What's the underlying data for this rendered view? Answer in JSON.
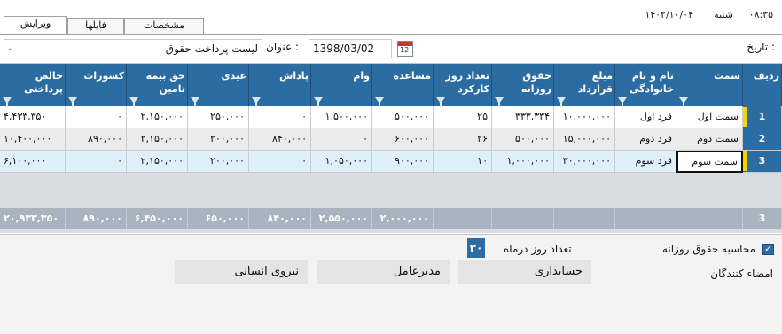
{
  "tabs": [
    {
      "label": "ویرایش",
      "active": true
    },
    {
      "label": "فایلها",
      "active": false
    },
    {
      "label": "مشخصات",
      "active": false
    }
  ],
  "status": {
    "time": "۰۸:۳۵",
    "day": "شنبه",
    "date": "۱۴۰۲/۱۰/۰۴"
  },
  "filter": {
    "date_label": "تاریخ :",
    "date_value": "1398/03/02",
    "title_label": "عنوان :",
    "title_value": "لیست پرداخت حقوق"
  },
  "grid": {
    "headers": [
      "ردیف",
      "سمت",
      "نام و نام خانوادگی",
      "مبلغ قرارداد",
      "حقوق روزانه",
      "تعداد روز کارکرد",
      "مساعده",
      "وام",
      "پاداش",
      "عیدی",
      "حق بیمه تامین",
      "کسورات",
      "خالص پرداختی"
    ],
    "rows": [
      {
        "no": "1",
        "cells": [
          "سمت اول",
          "فرد اول",
          "۱۰,۰۰۰,۰۰۰",
          "۳۳۳,۳۳۴",
          "۲۵",
          "۵۰۰,۰۰۰",
          "۱,۵۰۰,۰۰۰",
          "۰",
          "۲۵۰,۰۰۰",
          "۲,۱۵۰,۰۰۰",
          "۰",
          "۴,۴۳۳,۳۵۰"
        ]
      },
      {
        "no": "2",
        "cells": [
          "سمت دوم",
          "فرد دوم",
          "۱۵,۰۰۰,۰۰۰",
          "۵۰۰,۰۰۰",
          "۲۶",
          "۶۰۰,۰۰۰",
          "۰",
          "۸۴۰,۰۰۰",
          "۲۰۰,۰۰۰",
          "۲,۱۵۰,۰۰۰",
          "۸۹۰,۰۰۰",
          "۱۰,۴۰۰,۰۰۰"
        ]
      },
      {
        "no": "3",
        "cells": [
          "سمت سوم",
          "فرد سوم",
          "۳۰,۰۰۰,۰۰۰",
          "۱,۰۰۰,۰۰۰",
          "۱۰",
          "۹۰۰,۰۰۰",
          "۱,۰۵۰,۰۰۰",
          "۰",
          "۲۰۰,۰۰۰",
          "۲,۱۵۰,۰۰۰",
          "۰",
          "۶,۱۰۰,۰۰۰"
        ]
      }
    ],
    "summary": {
      "count": "3",
      "mosaede": "۲,۰۰۰,۰۰۰",
      "vam": "۲,۵۵۰,۰۰۰",
      "padash": "۸۴۰,۰۰۰",
      "eydi": "۶۵۰,۰۰۰",
      "bime": "۶,۴۵۰,۰۰۰",
      "kosurat": "۸۹۰,۰۰۰",
      "khales": "۲۰,۹۳۳,۳۵۰"
    }
  },
  "bottom": {
    "checkbox_label": "محاسبه حقوق روزانه",
    "days_label": "تعداد روز درماه",
    "days_value": "۳۰",
    "signers_label": "امضاء کنندگان",
    "signers": [
      "حسابداری",
      "مدیرعامل",
      "نیروی انسانی"
    ]
  },
  "colors": {
    "header": "#2b6ca3",
    "summary": "#a9b4c1",
    "row_marker": "#f5d500"
  }
}
